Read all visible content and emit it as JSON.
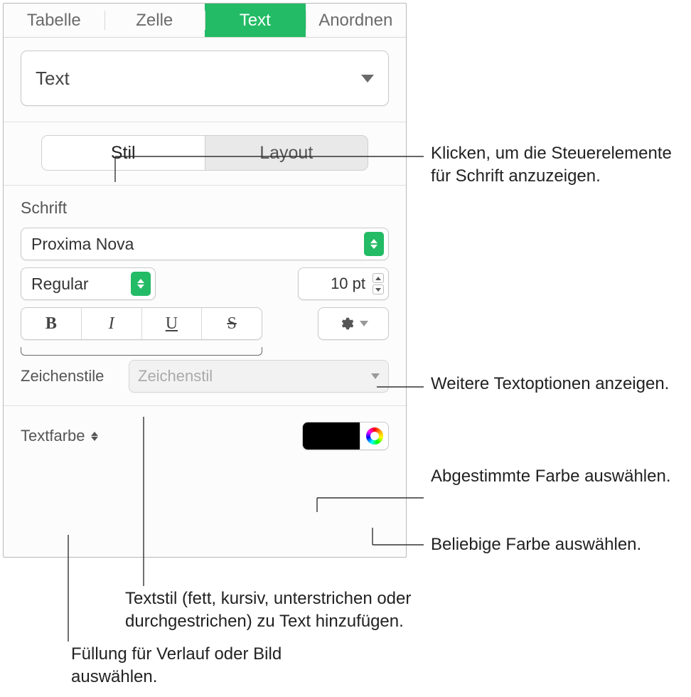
{
  "tabs": {
    "tabelle": "Tabelle",
    "zelle": "Zelle",
    "text": "Text",
    "anordnen": "Anordnen"
  },
  "paragraphStyle": "Text",
  "subTabs": {
    "stil": "Stil",
    "layout": "Layout"
  },
  "font": {
    "section": "Schrift",
    "family": "Proxima Nova",
    "weight": "Regular",
    "size": "10 pt",
    "bold": "B",
    "italic": "I",
    "underline": "U",
    "strike": "S"
  },
  "charStyles": {
    "label": "Zeichenstile",
    "placeholder": "Zeichenstil"
  },
  "textColor": {
    "label": "Textfarbe",
    "swatch": "#000000"
  },
  "callouts": {
    "stil": "Klicken, um die Steuerelemente für Schrift anzuzeigen.",
    "gear": "Weitere Textoptionen anzeigen.",
    "swatch": "Abgestimmte Farbe auswählen.",
    "wheel": "Beliebige Farbe auswählen.",
    "bius": "Textstil (fett, kursiv, unterstrichen oder durchgestrichen) zu Text hinzufügen.",
    "textcolor": "Füllung für Verlauf oder Bild auswählen."
  }
}
